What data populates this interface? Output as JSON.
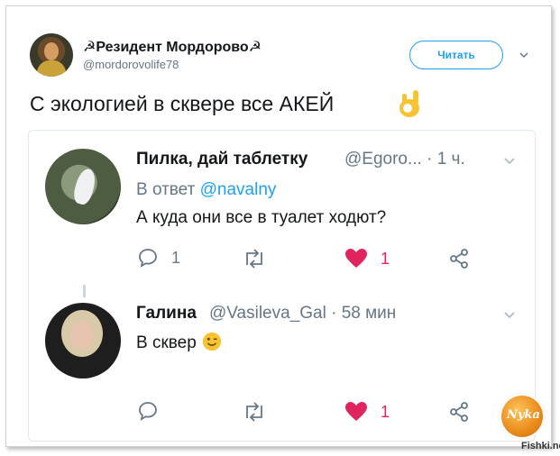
{
  "tweet": {
    "author_name": "☭Резидент Мордорово☭",
    "author_handle": "@mordorovolife78",
    "follow_label": "Читать",
    "text": "С экологией в сквере все АКЕЙ"
  },
  "replies": [
    {
      "name": "Пилка, дай таблетку",
      "handle_time": "@Egoro... · 1 ч.",
      "reply_prefix": "В ответ",
      "reply_to": "@navalny",
      "text": "А куда они все в туалет ходют?",
      "reply_count": "1",
      "retweet_count": "",
      "like_count": "1"
    },
    {
      "name": "Галина",
      "handle_time": "@Vasileva_Gal · 58 мин",
      "text": "В сквер",
      "reply_count": "",
      "retweet_count": "",
      "like_count": "1"
    }
  ],
  "watermark": {
    "logo_text": "Nyka",
    "site": "Fishki.net"
  },
  "colors": {
    "accent": "#1da1f2",
    "like": "#e0245e",
    "muted": "#657786"
  }
}
